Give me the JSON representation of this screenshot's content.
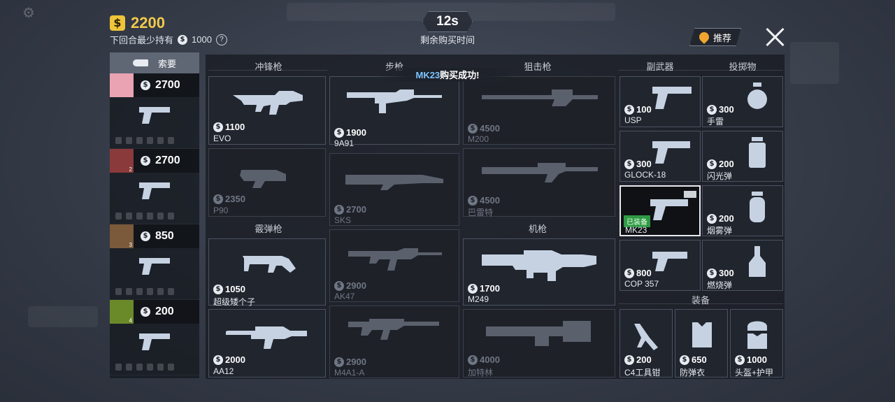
{
  "player": {
    "currency_icon": "$",
    "money": "2200",
    "min_hold_label": "下回合最少持有",
    "min_hold_value": "1000",
    "help_icon": "?"
  },
  "timer": {
    "value": "12s",
    "label": "剩余购买时间"
  },
  "recommend_label": "推荐",
  "toast": {
    "item": "MK23",
    "text": "购买成功!"
  },
  "team": {
    "request_label": "索要",
    "members": [
      {
        "money": "2700",
        "badge": "",
        "avatar_color": "#e9a3b2"
      },
      {
        "money": "2700",
        "badge": "2",
        "avatar_color": "#8a3a3a"
      },
      {
        "money": "850",
        "badge": "3",
        "avatar_color": "#7a5a3a"
      },
      {
        "money": "200",
        "badge": "4",
        "avatar_color": "#6a8a2a"
      }
    ]
  },
  "sections": {
    "smg": "冲锋枪",
    "rifle": "步枪",
    "sniper": "狙击枪",
    "pistol": "副武器",
    "grenade": "投掷物",
    "shotgun": "霰弹枪",
    "mg": "机枪",
    "equipment": "装备"
  },
  "items": {
    "evo": {
      "price": "1100",
      "name": "EVO"
    },
    "p90": {
      "price": "2350",
      "name": "P90"
    },
    "super_short": {
      "price": "1050",
      "name": "超级矮个子"
    },
    "aa12": {
      "price": "2000",
      "name": "AA12"
    },
    "9a91": {
      "price": "1900",
      "name": "9A91"
    },
    "sks": {
      "price": "2700",
      "name": "SKS"
    },
    "ak47": {
      "price": "2900",
      "name": "AK47"
    },
    "m4a1": {
      "price": "2900",
      "name": "M4A1-A"
    },
    "m200": {
      "price": "4500",
      "name": "M200"
    },
    "barrett": {
      "price": "4500",
      "name": "巴雷特"
    },
    "m249": {
      "price": "1700",
      "name": "M249"
    },
    "gatling": {
      "price": "4000",
      "name": "加特林"
    },
    "usp": {
      "price": "100",
      "name": "USP"
    },
    "glock": {
      "price": "300",
      "name": "GLOCK-18"
    },
    "mk23": {
      "price": "",
      "name": "MK23",
      "equipped": "已装备"
    },
    "cop357": {
      "price": "800",
      "name": "COP 357"
    },
    "frag": {
      "price": "300",
      "name": "手雷"
    },
    "flash": {
      "price": "200",
      "name": "闪光弹"
    },
    "smoke": {
      "price": "200",
      "name": "烟雾弹"
    },
    "molotov": {
      "price": "300",
      "name": "燃烧弹"
    },
    "c4": {
      "price": "200",
      "name": "C4工具钳"
    },
    "vest": {
      "price": "650",
      "name": "防弹衣"
    },
    "helmet": {
      "price": "1000",
      "name": "头盔+护甲"
    }
  }
}
